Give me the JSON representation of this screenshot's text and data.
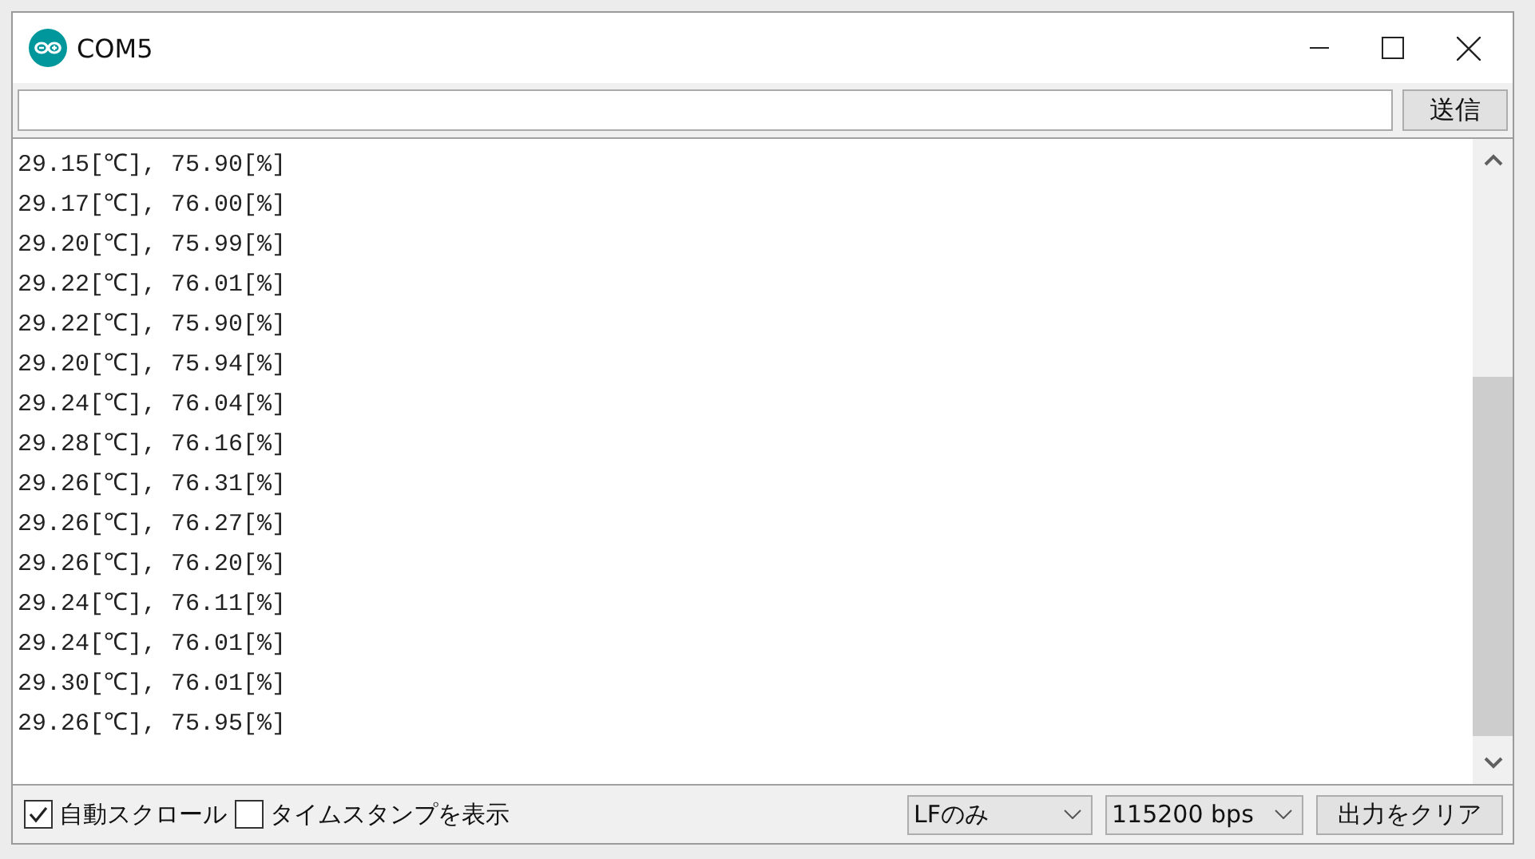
{
  "window": {
    "title": "COM5"
  },
  "send_button": "送信",
  "output_lines": [
    "29.15[℃], 75.90[%]",
    "29.17[℃], 76.00[%]",
    "29.20[℃], 75.99[%]",
    "29.22[℃], 76.01[%]",
    "29.22[℃], 75.90[%]",
    "29.20[℃], 75.94[%]",
    "29.24[℃], 76.04[%]",
    "29.28[℃], 76.16[%]",
    "29.26[℃], 76.31[%]",
    "29.26[℃], 76.27[%]",
    "29.26[℃], 76.20[%]",
    "29.24[℃], 76.11[%]",
    "29.24[℃], 76.01[%]",
    "29.30[℃], 76.01[%]",
    "29.26[℃], 75.95[%]"
  ],
  "options": [
    {
      "label": "自動スクロール",
      "checked": true
    },
    {
      "label": "タイムスタンプを表示",
      "checked": false
    }
  ],
  "dropdowns": [
    {
      "value": "LFのみ"
    },
    {
      "value": "115200 bps"
    }
  ],
  "clear_button": "出力をクリア"
}
